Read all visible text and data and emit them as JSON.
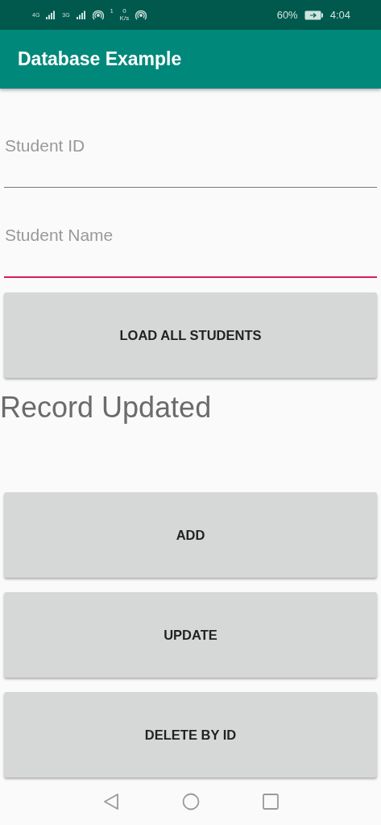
{
  "status_bar": {
    "network_1": "4G",
    "network_2": "3G",
    "hotspot_count": "1",
    "speed_value": "0",
    "speed_unit": "K/s",
    "battery": "60%",
    "time": "4:04"
  },
  "app_bar": {
    "title": "Database Example"
  },
  "fields": [
    {
      "placeholder": "Student ID",
      "focused": false
    },
    {
      "placeholder": "Student Name",
      "focused": true
    }
  ],
  "load_button": "LOAD ALL STUDENTS",
  "message": "Record Updated",
  "buttons": [
    "ADD",
    "UPDATE",
    "DELETE BY ID"
  ]
}
